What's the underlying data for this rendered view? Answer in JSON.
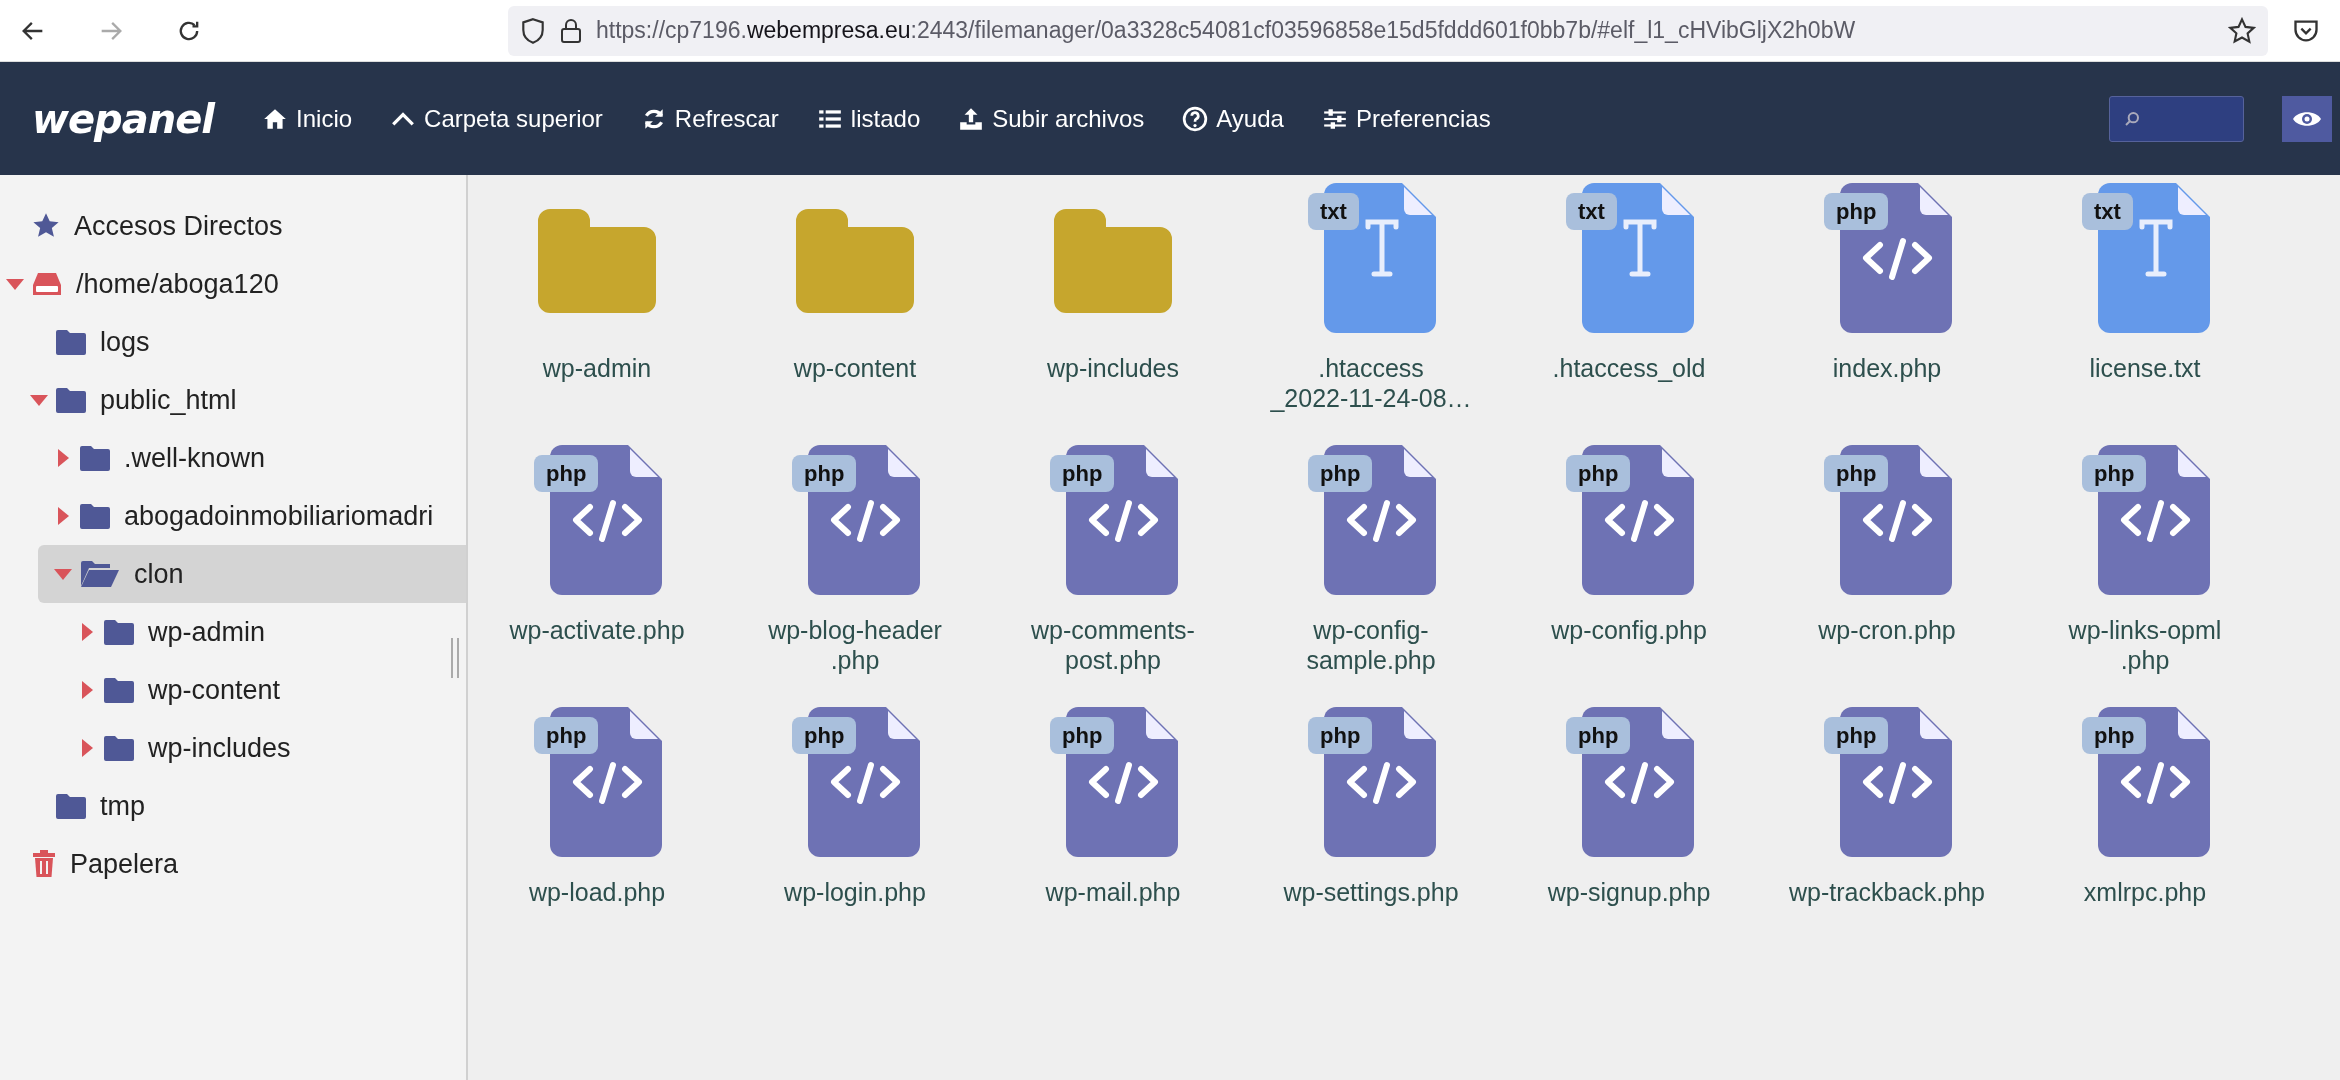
{
  "browser": {
    "url_prefix": "https://cp7196.",
    "url_domain": "webempresa.eu",
    "url_rest": ":2443/filemanager/0a3328c54081cf03596858e15d5fddd601f0bb7b/#elf_l1_cHVibGljX2h0bW"
  },
  "toolbar": {
    "logo": "wepanel",
    "buttons": [
      {
        "kind": "home",
        "label": "Inicio"
      },
      {
        "kind": "up",
        "label": "Carpeta superior"
      },
      {
        "kind": "refresh",
        "label": "Refrescar"
      },
      {
        "kind": "list",
        "label": "listado"
      },
      {
        "kind": "upload",
        "label": "Subir archivos"
      },
      {
        "kind": "help",
        "label": "Ayuda"
      },
      {
        "kind": "prefs",
        "label": "Preferencias"
      }
    ]
  },
  "sidebar": {
    "items": [
      {
        "kind": "shortcuts",
        "label": "Accesos Directos",
        "selected": false
      },
      {
        "kind": "drive",
        "label": "/home/aboga120",
        "selected": false,
        "expanded": true,
        "children": [
          {
            "kind": "folder",
            "label": "logs",
            "selected": false
          },
          {
            "kind": "folder",
            "label": "public_html",
            "selected": false,
            "expanded": true,
            "children": [
              {
                "kind": "folder",
                "label": ".well-known",
                "selected": false,
                "expanded": false
              },
              {
                "kind": "folder",
                "label": "abogadoinmobiliariomadri",
                "selected": false,
                "expanded": false
              },
              {
                "kind": "folder",
                "label": "clon",
                "selected": true,
                "expanded": true,
                "children": [
                  {
                    "kind": "folder",
                    "label": "wp-admin",
                    "selected": false,
                    "expanded": false
                  },
                  {
                    "kind": "folder",
                    "label": "wp-content",
                    "selected": false,
                    "expanded": false
                  },
                  {
                    "kind": "folder",
                    "label": "wp-includes",
                    "selected": false,
                    "expanded": false
                  }
                ]
              }
            ]
          },
          {
            "kind": "folder",
            "label": "tmp",
            "selected": false
          }
        ]
      },
      {
        "kind": "trash",
        "label": "Papelera",
        "selected": false
      }
    ]
  },
  "files": [
    {
      "kind": "folder",
      "name": [
        "wp-admin"
      ]
    },
    {
      "kind": "folder",
      "name": [
        "wp-content"
      ]
    },
    {
      "kind": "folder",
      "name": [
        "wp-includes"
      ]
    },
    {
      "kind": "text",
      "badge": "txt",
      "name": [
        ".htaccess",
        "_2022-11-24-08…"
      ]
    },
    {
      "kind": "text",
      "badge": "txt",
      "name": [
        ".htaccess_old"
      ]
    },
    {
      "kind": "code",
      "badge": "php",
      "name": [
        "index.php"
      ]
    },
    {
      "kind": "text",
      "badge": "txt",
      "name": [
        "license.txt"
      ]
    },
    {
      "kind": "code",
      "badge": "php",
      "name": [
        "wp-activate.php"
      ]
    },
    {
      "kind": "code",
      "badge": "php",
      "name": [
        "wp-blog-header",
        ".php"
      ]
    },
    {
      "kind": "code",
      "badge": "php",
      "name": [
        "wp-comments-",
        "post.php"
      ]
    },
    {
      "kind": "code",
      "badge": "php",
      "name": [
        "wp-config-",
        "sample.php"
      ]
    },
    {
      "kind": "code",
      "badge": "php",
      "name": [
        "wp-config.php"
      ]
    },
    {
      "kind": "code",
      "badge": "php",
      "name": [
        "wp-cron.php"
      ]
    },
    {
      "kind": "code",
      "badge": "php",
      "name": [
        "wp-links-opml",
        ".php"
      ]
    },
    {
      "kind": "code",
      "badge": "php",
      "name": [
        "wp-load.php"
      ]
    },
    {
      "kind": "code",
      "badge": "php",
      "name": [
        "wp-login.php"
      ]
    },
    {
      "kind": "code",
      "badge": "php",
      "name": [
        "wp-mail.php"
      ]
    },
    {
      "kind": "code",
      "badge": "php",
      "name": [
        "wp-settings.php"
      ]
    },
    {
      "kind": "code",
      "badge": "php",
      "name": [
        "wp-signup.php"
      ]
    },
    {
      "kind": "code",
      "badge": "php",
      "name": [
        "wp-trackback.php"
      ]
    },
    {
      "kind": "code",
      "badge": "php",
      "name": [
        "xmlrpc.php"
      ]
    }
  ]
}
